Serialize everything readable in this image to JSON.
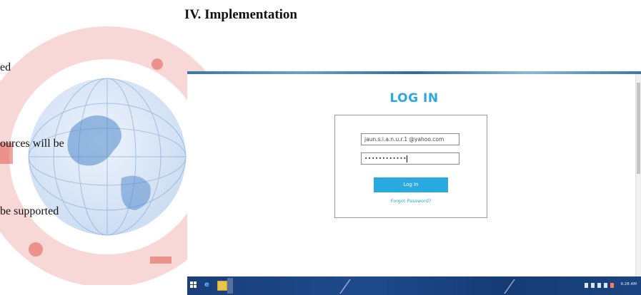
{
  "section_heading": "IV. Implementation",
  "text_fragments": [
    "ed",
    "ources will be",
    "be supported"
  ],
  "screenshot": {
    "login_title": "LOG IN",
    "email_value": "jaun.s.i.a.n.u.r.1 @yahoo.com",
    "password_value": "••••••••••••",
    "login_button": "Log In",
    "forgot_link": "Forgot Password?",
    "taskbar_time": "9:28 AM"
  },
  "colors": {
    "accent": "#29a9df",
    "taskbar": "#1a3f7a",
    "watermark_red": "#d9534f",
    "watermark_blue": "#3a7fc4"
  },
  "icons": {
    "start": "windows-start-icon",
    "browser": "internet-explorer-icon",
    "explorer": "file-explorer-icon"
  }
}
